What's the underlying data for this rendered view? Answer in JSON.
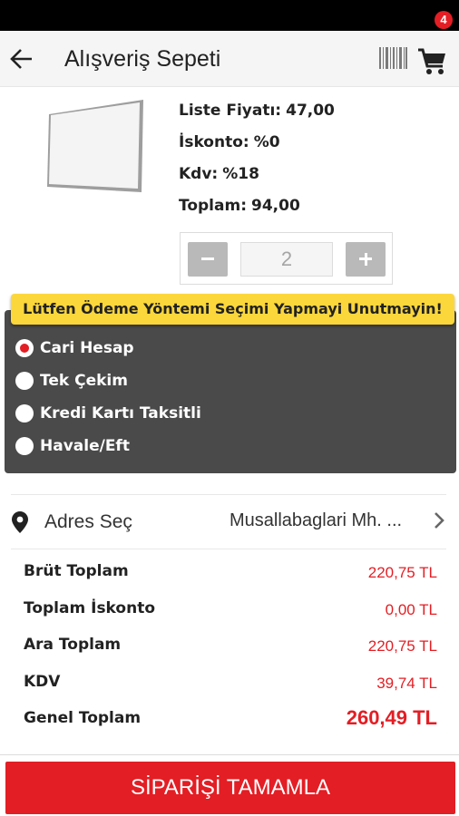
{
  "header": {
    "title": "Alışveriş Sepeti",
    "cart_count": "4",
    "icons": [
      "arrow-left-icon",
      "barcode-icon",
      "cart-icon"
    ]
  },
  "product": {
    "list_price_label": "Liste Fiyatı:",
    "list_price": "47,00",
    "discount_label": "İskonto:",
    "discount": "%0",
    "vat_label": "Kdv:",
    "vat": "%18",
    "total_label": "Toplam:",
    "total": "94,00",
    "quantity": "2"
  },
  "payment": {
    "warning": "Lütfen Ödeme Yöntemi Seçimi Yapmayi Unutmayin!",
    "options": [
      {
        "label": "Cari Hesap",
        "selected": true
      },
      {
        "label": "Tek Çekim",
        "selected": false
      },
      {
        "label": "Kredi Kartı Taksitli",
        "selected": false
      },
      {
        "label": "Havale/Eft",
        "selected": false
      }
    ]
  },
  "address": {
    "label": "Adres Seç",
    "value": "Musallabaglari Mh. ..."
  },
  "totals": [
    {
      "label": "Brüt Toplam",
      "value": "220,75 TL"
    },
    {
      "label": "Toplam İskonto",
      "value": "0,00 TL"
    },
    {
      "label": "Ara Toplam",
      "value": "220,75 TL"
    },
    {
      "label": "KDV",
      "value": "39,74 TL"
    },
    {
      "label": "Genel Toplam",
      "value": "260,49 TL"
    }
  ],
  "submit_label": "SİPARİŞİ TAMAMLA",
  "colors": {
    "accent": "#e31e24",
    "warning": "#fcd73b",
    "panel": "#4a4a4a"
  }
}
